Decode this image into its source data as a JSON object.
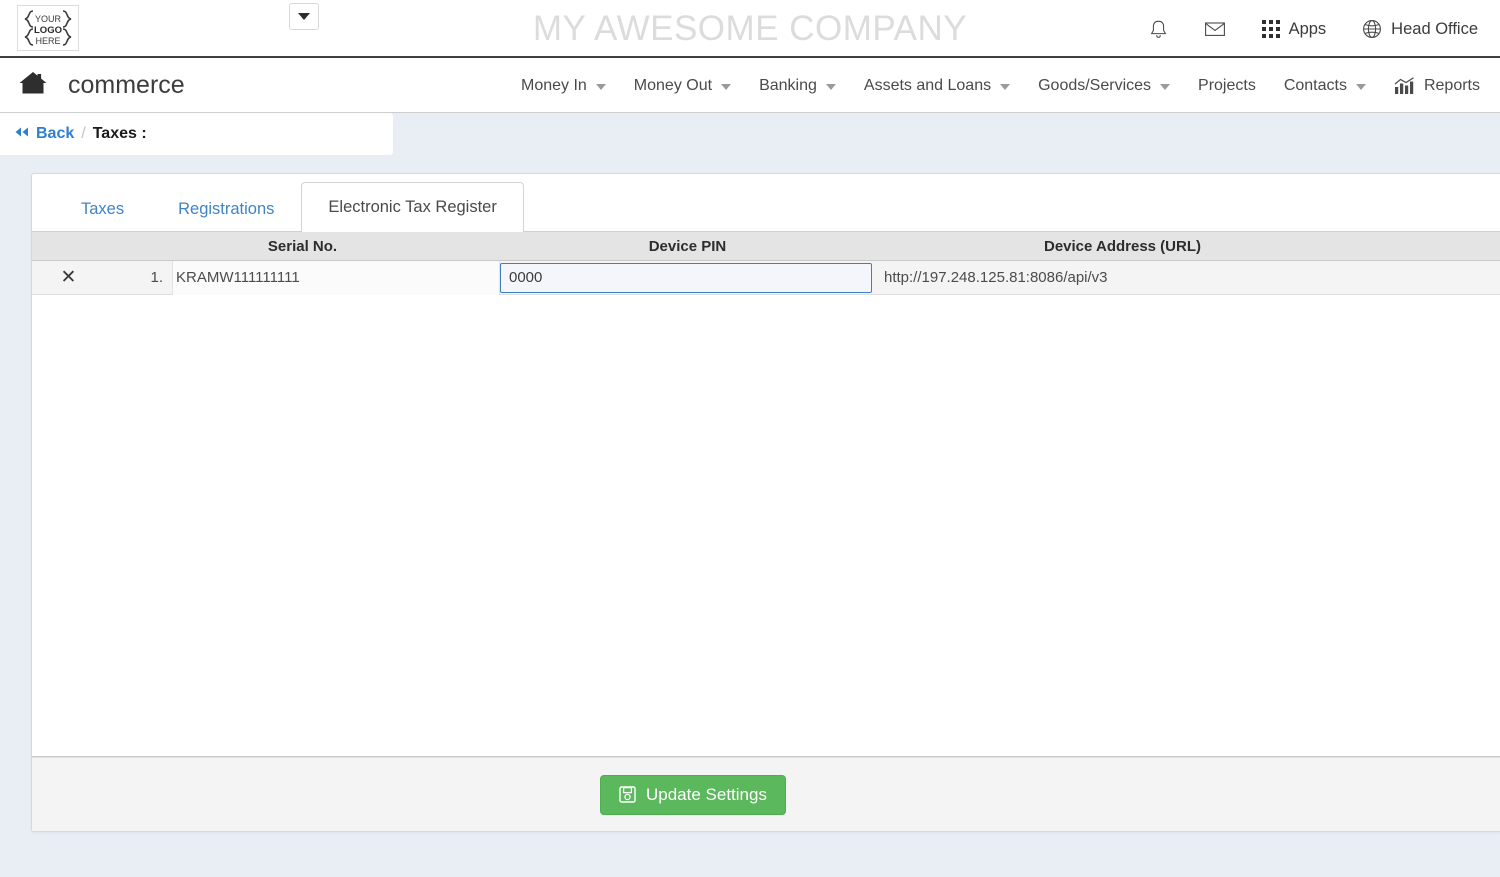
{
  "topbar": {
    "logo": {
      "line1": "YOUR",
      "line2": "LOGO",
      "line3": "HERE"
    },
    "company_selector_icon": "caret-down-icon",
    "company_name": "MY AWESOME COMPANY",
    "items": [
      {
        "icon": "bell-icon",
        "label": ""
      },
      {
        "icon": "envelope-icon",
        "label": ""
      },
      {
        "icon": "grid-icon",
        "label": "Apps"
      },
      {
        "icon": "globe-icon",
        "label": "Head Office"
      }
    ]
  },
  "nav": {
    "home_icon": "home-icon",
    "brand": "commerce",
    "items": [
      {
        "label": "Money In",
        "caret": true
      },
      {
        "label": "Money Out",
        "caret": true
      },
      {
        "label": "Banking",
        "caret": true
      },
      {
        "label": "Assets and Loans",
        "caret": true
      },
      {
        "label": "Goods/Services",
        "caret": true
      },
      {
        "label": "Projects",
        "caret": false
      },
      {
        "label": "Contacts",
        "caret": true
      },
      {
        "label": "Reports",
        "caret": false,
        "icon": "chart-icon"
      }
    ]
  },
  "breadcrumb": {
    "back_label": "Back",
    "separator": "/",
    "title": "Taxes :"
  },
  "tabs": [
    {
      "label": "Taxes",
      "active": false
    },
    {
      "label": "Registrations",
      "active": false
    },
    {
      "label": "Electronic Tax Register",
      "active": true
    }
  ],
  "table": {
    "columns": [
      "Serial No.",
      "Device PIN",
      "Device Address (URL)"
    ],
    "rows": [
      {
        "delete_icon": "close-icon",
        "index": "1.",
        "serial_no": "KRAMW111111111",
        "device_pin": "0000",
        "device_pin_placeholder": "",
        "device_address": "http://197.248.125.81:8086/api/v3"
      }
    ]
  },
  "footer": {
    "update_button": {
      "label": "Update Settings",
      "icon": "save-icon",
      "color": "#5cb85c"
    }
  },
  "colors": {
    "page_background": "#e9edf4",
    "link_blue": "#3f85c6",
    "back_blue": "#2f7fd0",
    "header_grey": "#e4e4e4",
    "focus_blue": "#3f7fbf",
    "company_name_grey": "#dcdcdc"
  }
}
